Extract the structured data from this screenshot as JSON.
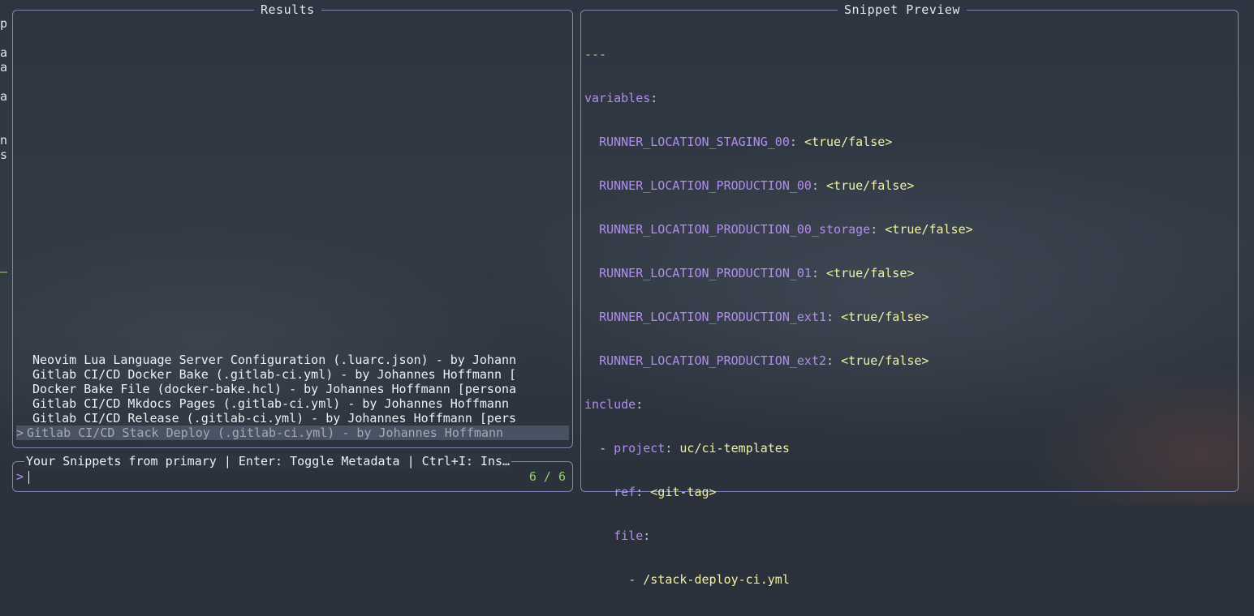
{
  "left_edge_glyphs": [
    "p",
    "",
    "a",
    "a",
    "",
    "a",
    "",
    "",
    "n",
    "s",
    "",
    "",
    "",
    "",
    "",
    "",
    "",
    "—"
  ],
  "results": {
    "title": "Results",
    "items": [
      "Neovim Lua Language Server Configuration (.luarc.json) - by Johann",
      "Gitlab CI/CD Docker Bake (.gitlab-ci.yml) - by Johannes Hoffmann [",
      "Docker Bake File (docker-bake.hcl) - by Johannes Hoffmann [persona",
      "Gitlab CI/CD Mkdocs Pages (.gitlab-ci.yml) - by Johannes Hoffmann ",
      "Gitlab CI/CD Release (.gitlab-ci.yml) - by Johannes Hoffmann [pers",
      "Gitlab CI/CD Stack Deploy (.gitlab-ci.yml) - by Johannes Hoffmann"
    ],
    "selected_marker": ">"
  },
  "prompt": {
    "header": "Your Snippets from primary | Enter: Toggle Metadata | Ctrl+I: Ins…",
    "caret": ">",
    "value": "",
    "counter": "6 / 6"
  },
  "preview": {
    "title": "Snippet Preview",
    "doc_start": "---",
    "variables_key": "variables",
    "variables": [
      {
        "key": "RUNNER_LOCATION_STAGING_00",
        "value": "<true/false>"
      },
      {
        "key": "RUNNER_LOCATION_PRODUCTION_00",
        "value": "<true/false>"
      },
      {
        "key": "RUNNER_LOCATION_PRODUCTION_00_storage",
        "value": "<true/false>"
      },
      {
        "key": "RUNNER_LOCATION_PRODUCTION_01",
        "value": "<true/false>"
      },
      {
        "key": "RUNNER_LOCATION_PRODUCTION_ext1",
        "value": "<true/false>"
      },
      {
        "key": "RUNNER_LOCATION_PRODUCTION_ext2",
        "value": "<true/false>"
      }
    ],
    "include_key": "include",
    "project_key": "project",
    "project_value": "uc/ci-templates",
    "ref_key": "ref",
    "ref_value": "<git-tag>",
    "file_key": "file",
    "file_value": "/stack-deploy-ci.yml"
  },
  "colors": {
    "border": "#7e86b8",
    "yaml_key": "#b18ded",
    "yaml_value": "#f0f2a0",
    "counter": "#8fd16a"
  }
}
